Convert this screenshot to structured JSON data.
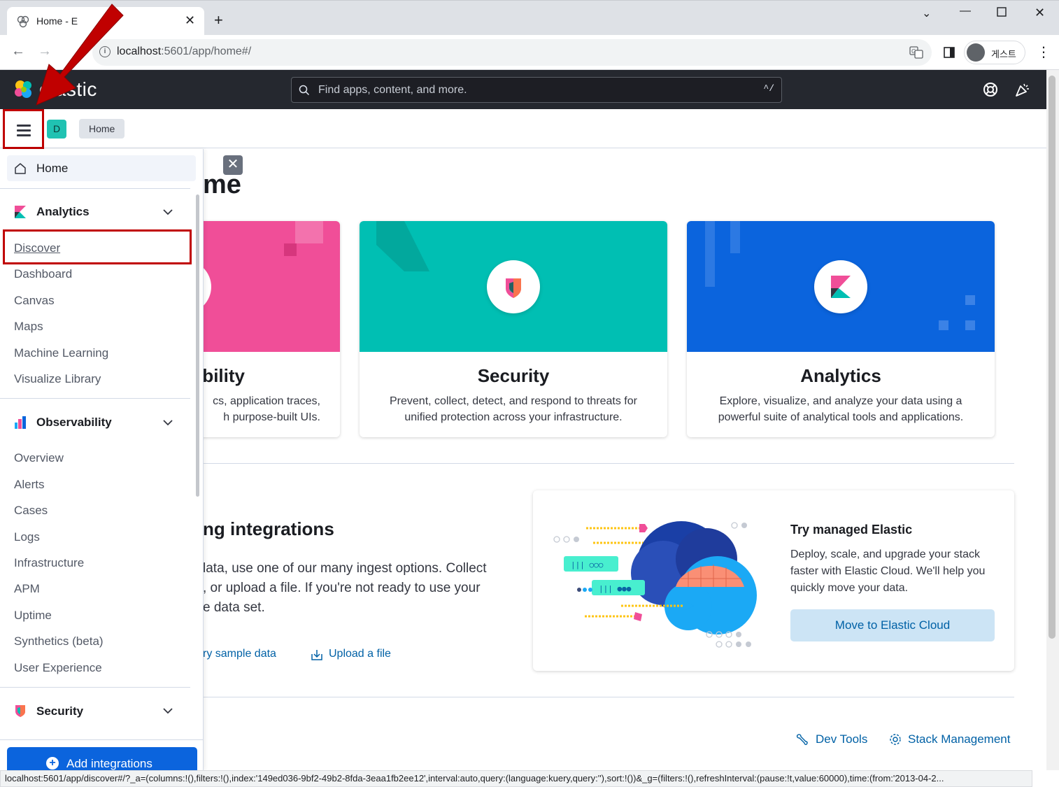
{
  "browser": {
    "tab_title": "Home - E",
    "url_host": "localhost",
    "url_rest": ":5601/app/home#/",
    "profile_name": "게스트"
  },
  "header": {
    "logo_text": "elastic",
    "search_placeholder": "Find apps, content, and more.",
    "search_shortcut": "^/"
  },
  "breadcrumb": {
    "space_initial": "D",
    "current": "Home"
  },
  "sidenav": {
    "home_label": "Home",
    "groups": [
      {
        "title": "Analytics",
        "items": [
          "Discover",
          "Dashboard",
          "Canvas",
          "Maps",
          "Machine Learning",
          "Visualize Library"
        ]
      },
      {
        "title": "Observability",
        "items": [
          "Overview",
          "Alerts",
          "Cases",
          "Logs",
          "Infrastructure",
          "APM",
          "Uptime",
          "Synthetics (beta)",
          "User Experience"
        ]
      },
      {
        "title": "Security",
        "items": []
      }
    ],
    "add_integrations": "Add integrations"
  },
  "main": {
    "page_title_partial": "me",
    "cards": [
      {
        "title": "bility",
        "desc": "cs, application traces,\nh purpose-built UIs.",
        "color": "#f04e98"
      },
      {
        "title": "Security",
        "desc": "Prevent, collect, detect, and respond to threats for unified protection across your infrastructure.",
        "color": "#00bfb3"
      },
      {
        "title": "Analytics",
        "desc": "Explore, visualize, and analyze your data using a powerful suite of analytical tools and applications.",
        "color": "#0b64dd"
      }
    ],
    "ingest_title": "ng integrations",
    "ingest_desc": "lata, use one of our many ingest options. Collect\n, or upload a file. If you're not ready to use your\ne data set.",
    "try_sample": "ry sample data",
    "upload_file": "Upload a file",
    "cloud": {
      "title": "Try managed Elastic",
      "desc": "Deploy, scale, and upgrade your stack faster with Elastic Cloud. We'll help you quickly move your data.",
      "button": "Move to Elastic Cloud"
    },
    "dev_tools": "Dev Tools",
    "stack_management": "Stack Management"
  },
  "status_url": "localhost:5601/app/discover#/?_a=(columns:!(),filters:!(),index:'149ed036-9bf2-49b2-8fda-3eaa1fb2ee12',interval:auto,query:(language:kuery,query:''),sort:!())&_g=(filters:!(),refreshInterval:(pause:!t,value:60000),time:(from:'2013-04-2..."
}
